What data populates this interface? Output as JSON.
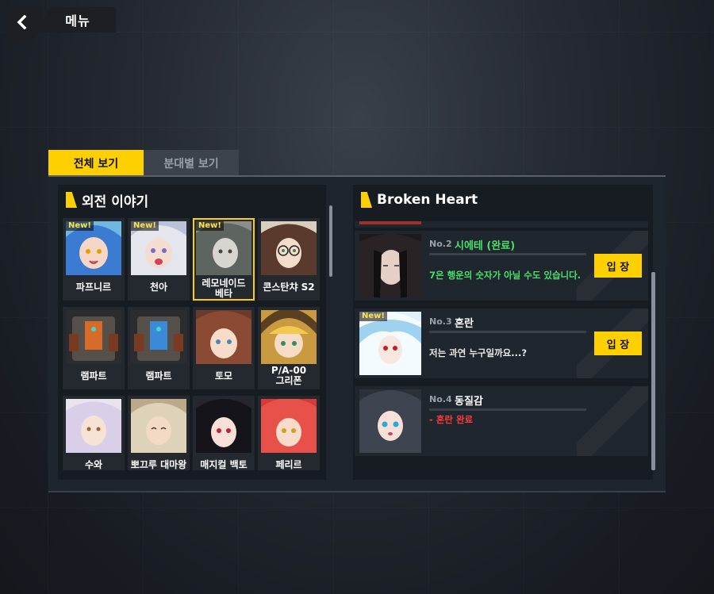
{
  "topbar": {
    "menu_label": "메뉴"
  },
  "tabs": {
    "all": "전체 보기",
    "by_squad": "분대별 보기"
  },
  "left_panel": {
    "title": "외전 이야기",
    "cards": [
      {
        "name": "파프니르",
        "new": true
      },
      {
        "name": "천아",
        "new": true
      },
      {
        "name": "레모네이드\n베타",
        "new": true,
        "selected": true
      },
      {
        "name": "콘스탄챠 S2",
        "new": false
      },
      {
        "name": "램파트",
        "new": false
      },
      {
        "name": "램파트",
        "new": false
      },
      {
        "name": "토모",
        "new": false
      },
      {
        "name": "P/A-00\n그리폰",
        "new": false
      },
      {
        "name": "수와",
        "new": false
      },
      {
        "name": "뽀끄루 대마왕",
        "new": false
      },
      {
        "name": "매지컬 백토",
        "new": false
      },
      {
        "name": "페리르",
        "new": false
      }
    ],
    "new_label": "New!"
  },
  "right_panel": {
    "title": "Broken Heart",
    "episodes": [
      {
        "no": "No.2",
        "title": "시에테 (완료)",
        "desc": "7은 행운의 숫자가 아닐 수도 있습니다.",
        "enter": "입 장",
        "done": true,
        "new": false
      },
      {
        "no": "No.3",
        "title": "혼란",
        "desc": "저는 과연 누구일까요...?",
        "enter": "입 장",
        "done": false,
        "new": true
      },
      {
        "no": "No.4",
        "title": "동질감",
        "desc": "- 혼란 완료",
        "enter": "",
        "done": false,
        "new": false,
        "locked": true
      }
    ],
    "new_label": "New!"
  },
  "colors": {
    "accent": "#ffd000",
    "done_green": "#47e06c",
    "locked_red": "#ff3b3b"
  }
}
